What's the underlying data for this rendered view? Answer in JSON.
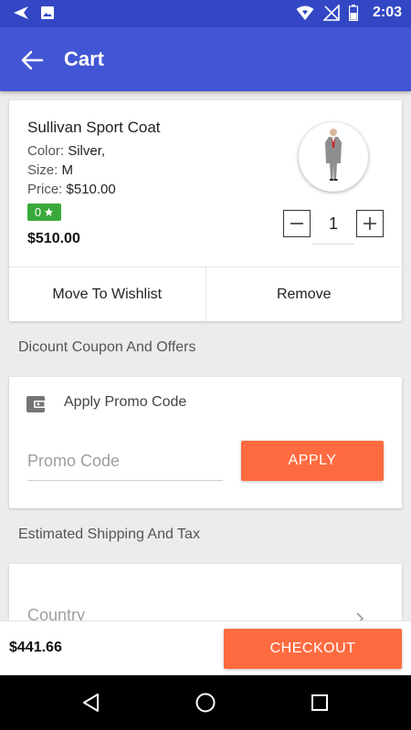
{
  "status_bar": {
    "time": "2:03"
  },
  "app_bar": {
    "title": "Cart"
  },
  "product": {
    "name": "Sullivan Sport Coat",
    "color_label": "Color: ",
    "color_value": "Silver,",
    "size_label": "Size: ",
    "size_value": "M",
    "price_label": "Price: ",
    "price_value": "$510.00",
    "rating": "0",
    "total": "$510.00",
    "quantity": "1",
    "move_to_wishlist": "Move To Wishlist",
    "remove": "Remove"
  },
  "coupon_section": {
    "heading": "Dicount Coupon And Offers",
    "promo_title": "Apply Promo Code",
    "promo_placeholder": "Promo Code",
    "apply_label": "APPLY"
  },
  "shipping_section": {
    "heading": "Estimated Shipping And Tax",
    "country_label": "Country"
  },
  "checkout": {
    "total": "$441.66",
    "button_label": "CHECKOUT"
  },
  "colors": {
    "status_bar": "#3347c4",
    "app_bar": "#4255d4",
    "accent": "#ff6b40",
    "rating_badge": "#3aa93a"
  }
}
